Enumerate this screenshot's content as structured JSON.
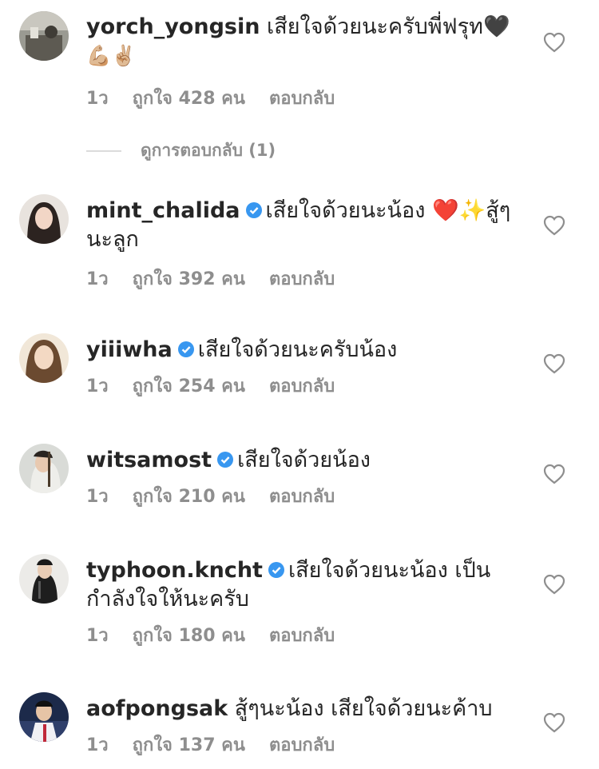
{
  "comments": [
    {
      "username": "yorch_yongsin",
      "verified": false,
      "text": "เสียใจด้วยนะครับพี่ฟรุท🖤",
      "emoji_line": "💪🏼✌🏼",
      "time": "1ว",
      "likes": "ถูกใจ 428 คน",
      "reply": "ตอบกลับ"
    },
    {
      "username": "mint_chalida",
      "verified": true,
      "text": "เสียใจด้วยนะน้อง ❤️✨สู้ๆ",
      "text_line2": "นะลูก",
      "time": "1ว",
      "likes": "ถูกใจ 392 คน",
      "reply": "ตอบกลับ"
    },
    {
      "username": "yiiiwha",
      "verified": true,
      "text": "เสียใจด้วยนะครับน้อง",
      "time": "1ว",
      "likes": "ถูกใจ 254 คน",
      "reply": "ตอบกลับ"
    },
    {
      "username": "witsamost",
      "verified": true,
      "text": "เสียใจด้วยน้อง",
      "time": "1ว",
      "likes": "ถูกใจ 210 คน",
      "reply": "ตอบกลับ"
    },
    {
      "username": "typhoon.kncht",
      "verified": true,
      "text": "เสียใจด้วยนะน้อง เป็น",
      "text_line2": "กำลังใจให้นะครับ",
      "time": "1ว",
      "likes": "ถูกใจ 180 คน",
      "reply": "ตอบกลับ"
    },
    {
      "username": "aofpongsak",
      "verified": false,
      "text": "สู้ๆนะน้อง เสียใจด้วยนะค้าบ",
      "time": "1ว",
      "likes": "ถูกใจ 137 คน",
      "reply": "ตอบกลับ"
    }
  ],
  "view_replies": "ดูการตอบกลับ (1)",
  "colors": {
    "text": "#262626",
    "meta": "#8e8e8e",
    "verified": "#3897f0",
    "divider": "#dbdbdb"
  },
  "icons": [
    "heart-outline-icon",
    "verified-badge-icon"
  ]
}
